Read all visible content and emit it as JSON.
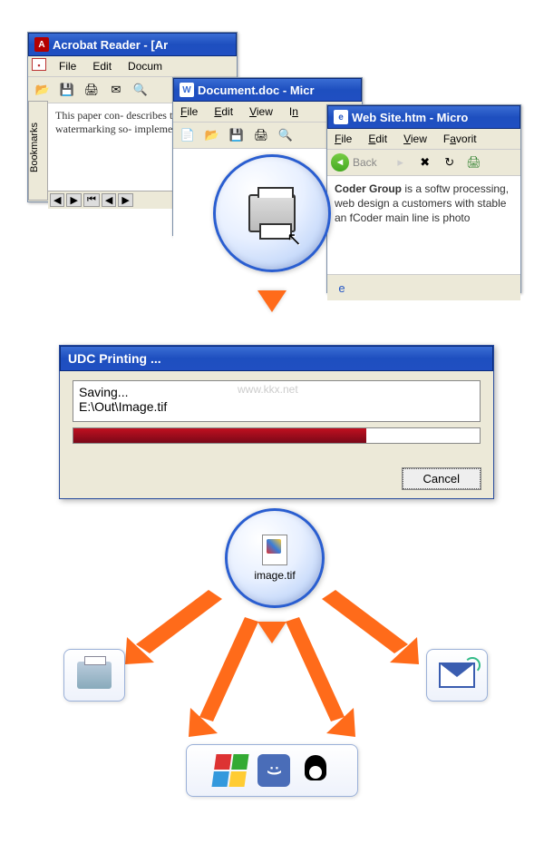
{
  "windows": {
    "acrobat": {
      "title": "Acrobat Reader - [Ar",
      "menu": [
        "File",
        "Edit",
        "Docum"
      ],
      "bookmarks_label": "Bookmarks",
      "content": "This paper con- describes the pri- watermarking so- implementation",
      "scroll_controls": [
        "◀",
        "▶",
        "⏮",
        "◀",
        "▶"
      ]
    },
    "word": {
      "title": "Document.doc - Micr",
      "menu": [
        "File",
        "Edit",
        "View",
        "In"
      ]
    },
    "ie": {
      "title": "Web Site.htm - Micro",
      "menu": [
        "File",
        "Edit",
        "View",
        "Favorit"
      ],
      "back_label": "Back",
      "content_strong": "Coder Group",
      "content_rest": " is a softw processing, web design a customers with stable an fCoder main line is photo"
    }
  },
  "dialog": {
    "title": "UDC Printing ...",
    "status": "Saving...",
    "path": "E:\\Out\\Image.tif",
    "cancel": "Cancel",
    "progress_pct": 72
  },
  "watermark": "www.kkx.net",
  "output_file": {
    "label": "image.tif"
  },
  "colors": {
    "title_blue": "#2b5ecf",
    "accent_orange": "#ff6b1a",
    "progress_red": "#a81224"
  }
}
